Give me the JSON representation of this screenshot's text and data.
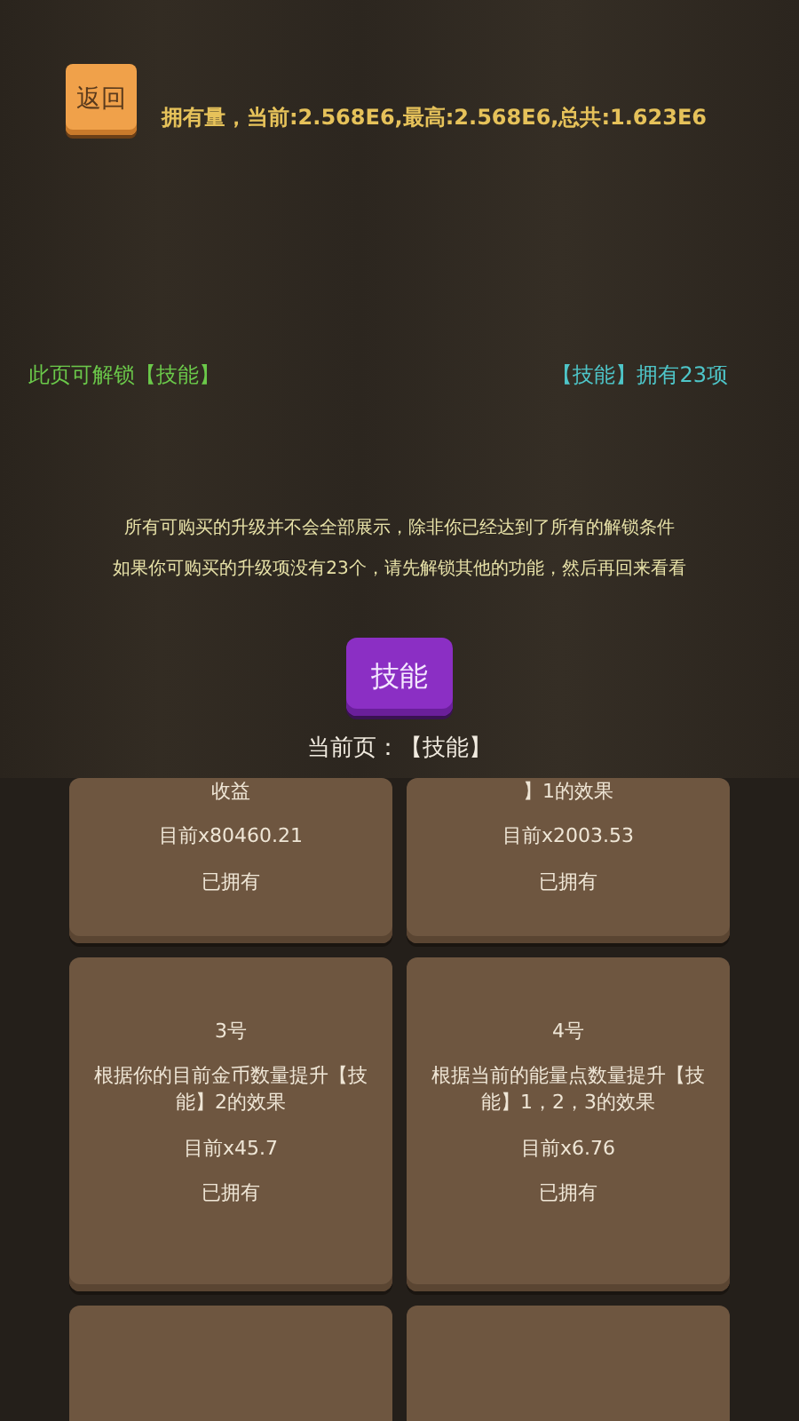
{
  "back_button": {
    "label": "返回"
  },
  "stats": "拥有量，当前:2.568E6,最高:2.568E6,总共:1.623E6",
  "unlock_info": {
    "left": "此页可解锁【技能】",
    "right": "【技能】拥有23项"
  },
  "notes": [
    "所有可购买的升级并不会全部展示，除非你已经达到了所有的解锁条件",
    "如果你可购买的升级项没有23个，请先解锁其他的功能，然后再回来看看"
  ],
  "category_button": {
    "label": "技能"
  },
  "current_page": "当前页：【技能】",
  "cards": [
    {
      "kind": "text",
      "lines": [
        "收益",
        "目前x80460.21",
        "已拥有"
      ]
    },
    {
      "kind": "text",
      "lines": [
        "】1的效果",
        "目前x2003.53",
        "已拥有"
      ]
    },
    {
      "kind": "text",
      "lines": [
        "3号",
        "根据你的目前金币数量提升【技能】2的效果",
        "目前x45.7",
        "已拥有"
      ]
    },
    {
      "kind": "text",
      "lines": [
        "4号",
        "根据当前的能量点数量提升【技能】1，2，3的效果",
        "目前x6.76",
        "已拥有"
      ]
    },
    {
      "kind": "cut"
    },
    {
      "kind": "cut"
    }
  ]
}
